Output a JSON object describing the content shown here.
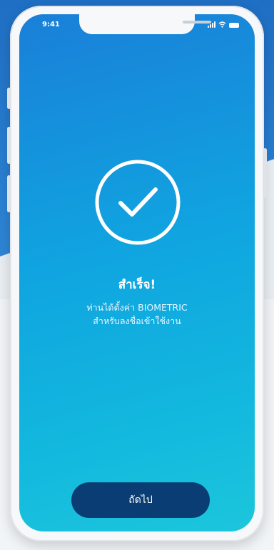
{
  "status_bar": {
    "time": "9:41",
    "icons": [
      "signal-icon",
      "wifi-icon",
      "battery-icon"
    ]
  },
  "success": {
    "icon": "check-circle-icon",
    "title": "สำเร็จ!",
    "description_line1": "ท่านได้ตั้งค่า BIOMETRIC",
    "description_line2": "สำหรับลงชื่อเข้าใช้งาน"
  },
  "actions": {
    "next_label": "ถัดไป"
  },
  "colors": {
    "gradient_top": "#1a7fd8",
    "gradient_bottom": "#1cc6dc",
    "button_bg": "#0a3d73",
    "text": "#ffffff"
  }
}
